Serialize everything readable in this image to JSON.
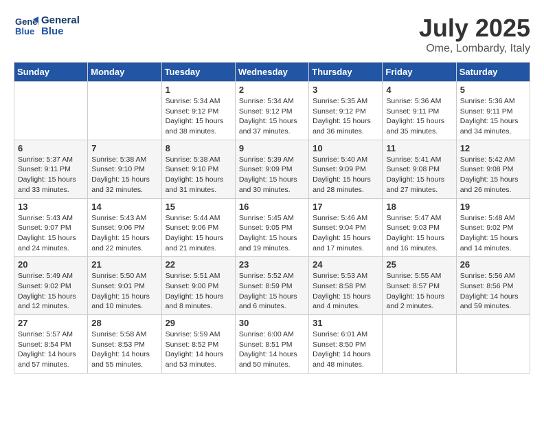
{
  "header": {
    "logo_line1": "General",
    "logo_line2": "Blue",
    "month": "July 2025",
    "location": "Ome, Lombardy, Italy"
  },
  "weekdays": [
    "Sunday",
    "Monday",
    "Tuesday",
    "Wednesday",
    "Thursday",
    "Friday",
    "Saturday"
  ],
  "weeks": [
    [
      {
        "day": "",
        "detail": ""
      },
      {
        "day": "",
        "detail": ""
      },
      {
        "day": "1",
        "detail": "Sunrise: 5:34 AM\nSunset: 9:12 PM\nDaylight: 15 hours\nand 38 minutes."
      },
      {
        "day": "2",
        "detail": "Sunrise: 5:34 AM\nSunset: 9:12 PM\nDaylight: 15 hours\nand 37 minutes."
      },
      {
        "day": "3",
        "detail": "Sunrise: 5:35 AM\nSunset: 9:12 PM\nDaylight: 15 hours\nand 36 minutes."
      },
      {
        "day": "4",
        "detail": "Sunrise: 5:36 AM\nSunset: 9:11 PM\nDaylight: 15 hours\nand 35 minutes."
      },
      {
        "day": "5",
        "detail": "Sunrise: 5:36 AM\nSunset: 9:11 PM\nDaylight: 15 hours\nand 34 minutes."
      }
    ],
    [
      {
        "day": "6",
        "detail": "Sunrise: 5:37 AM\nSunset: 9:11 PM\nDaylight: 15 hours\nand 33 minutes."
      },
      {
        "day": "7",
        "detail": "Sunrise: 5:38 AM\nSunset: 9:10 PM\nDaylight: 15 hours\nand 32 minutes."
      },
      {
        "day": "8",
        "detail": "Sunrise: 5:38 AM\nSunset: 9:10 PM\nDaylight: 15 hours\nand 31 minutes."
      },
      {
        "day": "9",
        "detail": "Sunrise: 5:39 AM\nSunset: 9:09 PM\nDaylight: 15 hours\nand 30 minutes."
      },
      {
        "day": "10",
        "detail": "Sunrise: 5:40 AM\nSunset: 9:09 PM\nDaylight: 15 hours\nand 28 minutes."
      },
      {
        "day": "11",
        "detail": "Sunrise: 5:41 AM\nSunset: 9:08 PM\nDaylight: 15 hours\nand 27 minutes."
      },
      {
        "day": "12",
        "detail": "Sunrise: 5:42 AM\nSunset: 9:08 PM\nDaylight: 15 hours\nand 26 minutes."
      }
    ],
    [
      {
        "day": "13",
        "detail": "Sunrise: 5:43 AM\nSunset: 9:07 PM\nDaylight: 15 hours\nand 24 minutes."
      },
      {
        "day": "14",
        "detail": "Sunrise: 5:43 AM\nSunset: 9:06 PM\nDaylight: 15 hours\nand 22 minutes."
      },
      {
        "day": "15",
        "detail": "Sunrise: 5:44 AM\nSunset: 9:06 PM\nDaylight: 15 hours\nand 21 minutes."
      },
      {
        "day": "16",
        "detail": "Sunrise: 5:45 AM\nSunset: 9:05 PM\nDaylight: 15 hours\nand 19 minutes."
      },
      {
        "day": "17",
        "detail": "Sunrise: 5:46 AM\nSunset: 9:04 PM\nDaylight: 15 hours\nand 17 minutes."
      },
      {
        "day": "18",
        "detail": "Sunrise: 5:47 AM\nSunset: 9:03 PM\nDaylight: 15 hours\nand 16 minutes."
      },
      {
        "day": "19",
        "detail": "Sunrise: 5:48 AM\nSunset: 9:02 PM\nDaylight: 15 hours\nand 14 minutes."
      }
    ],
    [
      {
        "day": "20",
        "detail": "Sunrise: 5:49 AM\nSunset: 9:02 PM\nDaylight: 15 hours\nand 12 minutes."
      },
      {
        "day": "21",
        "detail": "Sunrise: 5:50 AM\nSunset: 9:01 PM\nDaylight: 15 hours\nand 10 minutes."
      },
      {
        "day": "22",
        "detail": "Sunrise: 5:51 AM\nSunset: 9:00 PM\nDaylight: 15 hours\nand 8 minutes."
      },
      {
        "day": "23",
        "detail": "Sunrise: 5:52 AM\nSunset: 8:59 PM\nDaylight: 15 hours\nand 6 minutes."
      },
      {
        "day": "24",
        "detail": "Sunrise: 5:53 AM\nSunset: 8:58 PM\nDaylight: 15 hours\nand 4 minutes."
      },
      {
        "day": "25",
        "detail": "Sunrise: 5:55 AM\nSunset: 8:57 PM\nDaylight: 15 hours\nand 2 minutes."
      },
      {
        "day": "26",
        "detail": "Sunrise: 5:56 AM\nSunset: 8:56 PM\nDaylight: 14 hours\nand 59 minutes."
      }
    ],
    [
      {
        "day": "27",
        "detail": "Sunrise: 5:57 AM\nSunset: 8:54 PM\nDaylight: 14 hours\nand 57 minutes."
      },
      {
        "day": "28",
        "detail": "Sunrise: 5:58 AM\nSunset: 8:53 PM\nDaylight: 14 hours\nand 55 minutes."
      },
      {
        "day": "29",
        "detail": "Sunrise: 5:59 AM\nSunset: 8:52 PM\nDaylight: 14 hours\nand 53 minutes."
      },
      {
        "day": "30",
        "detail": "Sunrise: 6:00 AM\nSunset: 8:51 PM\nDaylight: 14 hours\nand 50 minutes."
      },
      {
        "day": "31",
        "detail": "Sunrise: 6:01 AM\nSunset: 8:50 PM\nDaylight: 14 hours\nand 48 minutes."
      },
      {
        "day": "",
        "detail": ""
      },
      {
        "day": "",
        "detail": ""
      }
    ]
  ]
}
